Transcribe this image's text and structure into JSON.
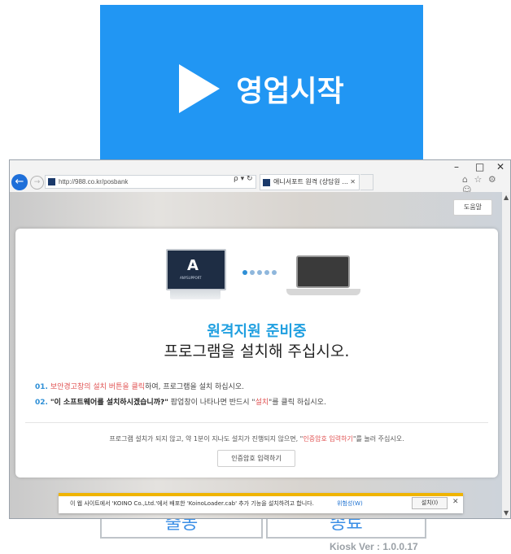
{
  "kiosk": {
    "start_label": "영업시작",
    "version": "Kiosk Ver : 1.0.0.17"
  },
  "browser": {
    "window_controls": {
      "minimize": "–",
      "maximize": "□",
      "close": "✕"
    },
    "address": "http://988.co.kr/posbank",
    "address_tools": "ρ ▾ ↻",
    "tab_title": "애니서포트 원격 (상담원 ...",
    "tab_close": "✕",
    "toolbar_icons": "⌂ ☆ ⚙ ☺"
  },
  "page": {
    "help_label": "도움말",
    "modal": {
      "monitor_logo": "A",
      "monitor_logo_text": "ANYSUPPORT",
      "dot_colors": [
        "#2e8fd6",
        "#8fb7dc",
        "#8fb7dc",
        "#8fb7dc",
        "#8fb7dc"
      ],
      "title": "원격지원 준비중",
      "subtitle": "프로그램을 설치해 주십시오.",
      "step1": {
        "num": "01.",
        "highlight": "보안경고창의 설치 버튼을 클릭",
        "rest": "하여, 프로그램을 설치 하십시오."
      },
      "step2": {
        "num": "02.",
        "bold": "\"이 소프트웨어를 설치하시겠습니까?\"",
        "middle": " 팝업창이 나타나면 반드시 \"",
        "highlight": "설치",
        "rest": "\"를 클릭 하십시오."
      },
      "note": {
        "pre": "프로그램 설치가 되지 않고, 약 1분이 지나도 설치가 진행되지 않으면, \"",
        "highlight": "인증암호 입력하기",
        "post": "\"를 눌러 주십시오."
      },
      "auth_button": "인증암호 입력하기"
    }
  },
  "infobar": {
    "message": "이 웹 사이트에서 'KOINO Co.,Ltd.'에서 배포한 'KoinoLoader.cab' 추가 기능을 설치하려고 합니다.",
    "risk_link": "위험성(W)",
    "install_button": "설치(I)",
    "close": "✕"
  },
  "kiosk_bottom": {
    "btn1": "출동",
    "btn2": "종료"
  },
  "colors": {
    "accent_blue": "#2196F3",
    "title_blue": "#1f9fe0",
    "warning_red": "#e05252",
    "infobar_yellow": "#f0b400"
  }
}
